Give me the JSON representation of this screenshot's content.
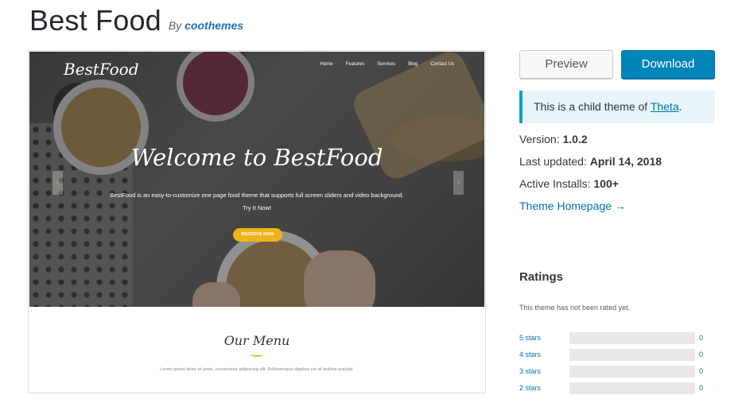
{
  "theme": {
    "title": "Best Food",
    "by_prefix": "By",
    "author": "coothemes"
  },
  "preview": {
    "logo": "BestFood",
    "nav": [
      "Home",
      "Features",
      "Services",
      "Blog",
      "Contact Us"
    ],
    "welcome": "Welcome to BestFood",
    "tagline": "BestFood is an easy-to-customize one page food theme that supports full screen sliders and video background.",
    "try_it": "Try It Now!",
    "reserve_label": "RESERVE NOW",
    "menu_title": "Our Menu",
    "menu_desc": "Lorem ipsum dolor sit amet, consectetur adipiscing elit. Pellentesque dapibus est at facilisis suscipit.",
    "arrow_left": "‹",
    "arrow_right": "›"
  },
  "actions": {
    "preview_label": "Preview",
    "download_label": "Download"
  },
  "notice": {
    "prefix": "This is a child theme of ",
    "parent": "Theta",
    "suffix": "."
  },
  "meta": {
    "version_label": "Version:",
    "version": "1.0.2",
    "updated_label": "Last updated:",
    "updated": "April 14, 2018",
    "installs_label": "Active Installs:",
    "installs": "100+",
    "homepage": "Theme Homepage →"
  },
  "ratings": {
    "title": "Ratings",
    "not_rated": "This theme has not been rated yet.",
    "rows": [
      {
        "label": "5 stars",
        "count": "0"
      },
      {
        "label": "4 stars",
        "count": "0"
      },
      {
        "label": "3 stars",
        "count": "0"
      },
      {
        "label": "2 stars",
        "count": "0"
      }
    ]
  },
  "colors": {
    "accent": "#0085ba",
    "link": "#0073aa",
    "notice_bg": "#e5f5fa",
    "notice_border": "#00a0d2",
    "reserve": "#f0b21a"
  }
}
